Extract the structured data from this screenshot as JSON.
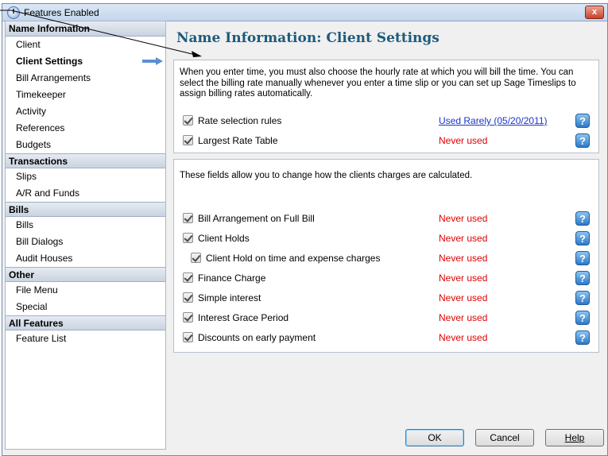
{
  "window": {
    "title": "Features Enabled",
    "close_label": "x"
  },
  "sidebar": {
    "groups": [
      {
        "header": "Name Information",
        "items": [
          "Client",
          "Client Settings",
          "Bill Arrangements",
          "Timekeeper",
          "Activity",
          "References",
          "Budgets"
        ]
      },
      {
        "header": "Transactions",
        "items": [
          "Slips",
          "A/R and Funds"
        ]
      },
      {
        "header": "Bills",
        "items": [
          "Bills",
          "Bill Dialogs",
          "Audit Houses"
        ]
      },
      {
        "header": "Other",
        "items": [
          "File Menu",
          "Special"
        ]
      },
      {
        "header": "All Features",
        "items": [
          "Feature List"
        ]
      }
    ],
    "selected": "Client Settings"
  },
  "main": {
    "title": "Name Information: Client Settings",
    "panel1": {
      "intro": "When you enter time, you must also choose the hourly rate at which you will bill the time. You can select the billing rate manually whenever you enter a time slip or you can set up Sage Timeslips to assign billing rates automatically.",
      "rows": [
        {
          "label": "Rate selection rules",
          "status": "Used Rarely (05/20/2011)",
          "checked": true
        },
        {
          "label": "Largest Rate Table",
          "status": "Never used",
          "checked": true
        }
      ]
    },
    "panel2": {
      "intro": "These fields allow you to change how the clients charges are calculated.",
      "rows": [
        {
          "label": "Bill Arrangement on Full Bill",
          "status": "Never used",
          "checked": true
        },
        {
          "label": "Client Holds",
          "status": "Never used",
          "checked": true
        },
        {
          "label": "Client Hold on time and expense charges",
          "status": "Never used",
          "checked": true
        },
        {
          "label": "Finance Charge",
          "status": "Never used",
          "checked": true
        },
        {
          "label": "Simple interest",
          "status": "Never used",
          "checked": true
        },
        {
          "label": "Interest Grace Period",
          "status": "Never used",
          "checked": true
        },
        {
          "label": "Discounts on early payment",
          "status": "Never used",
          "checked": true
        }
      ]
    }
  },
  "buttons": {
    "ok": "OK",
    "cancel": "Cancel",
    "help": "Help"
  },
  "colors": {
    "status_never": "#e00000",
    "status_link": "#1a33cc",
    "title": "#1d5b7d"
  }
}
